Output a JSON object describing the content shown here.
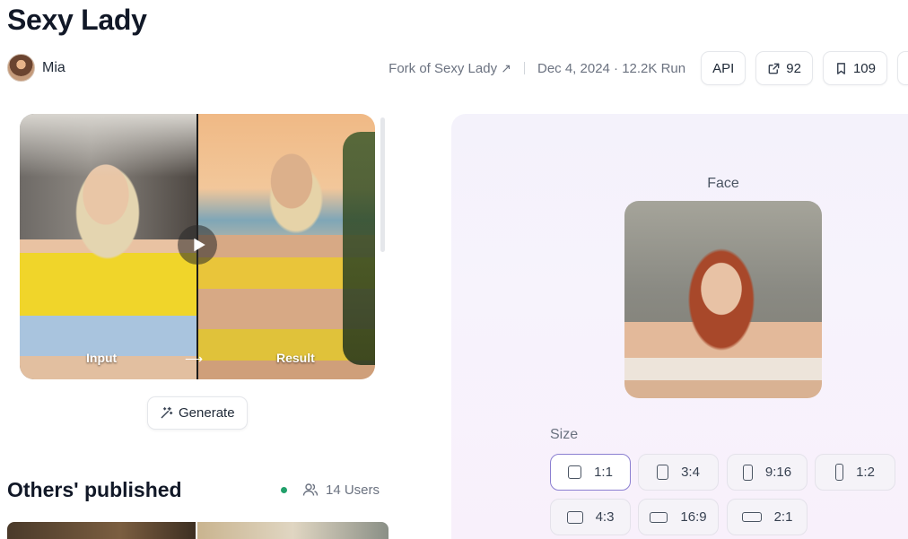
{
  "header": {
    "title": "Sexy Lady",
    "author": "Mia",
    "fork_prefix": "Fork of",
    "fork_name": "Sexy Lady",
    "fork_arrow": "↗",
    "date_runs": "Dec 4, 2024 · 12.2K Run",
    "api_label": "API",
    "share_count": "92",
    "bookmark_count": "109"
  },
  "preview": {
    "input_label": "Input",
    "result_label": "Result",
    "arrow": "⟶",
    "generate_label": "Generate"
  },
  "others": {
    "title": "Others' published",
    "users_label": "14 Users",
    "status_color": "#22a06b"
  },
  "panel": {
    "face_label": "Face",
    "size_label": "Size",
    "sizes": [
      "1:1",
      "3:4",
      "9:16",
      "1:2",
      "4:3",
      "16:9",
      "2:1"
    ],
    "selected_size": "1:1",
    "accent_color": "#8b7fd1"
  }
}
